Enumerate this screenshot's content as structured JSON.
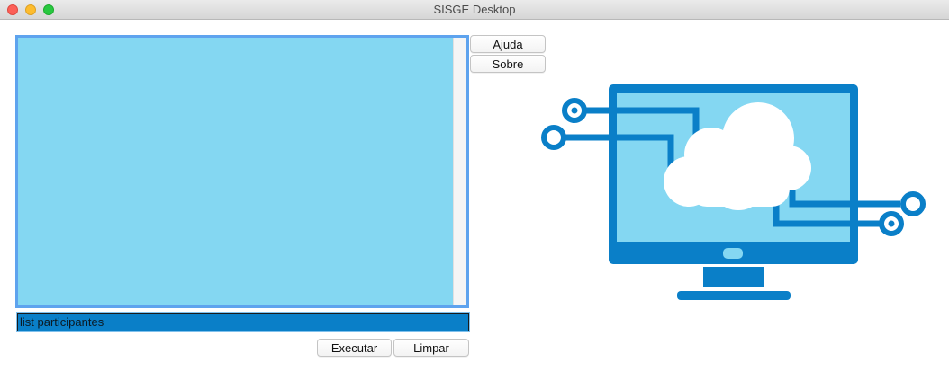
{
  "window": {
    "title": "SISGE Desktop"
  },
  "buttons": {
    "help": "Ajuda",
    "about": "Sobre",
    "execute": "Executar",
    "clear": "Limpar"
  },
  "command": {
    "value": "list participantes"
  },
  "output": {
    "text": ""
  },
  "illustration": {
    "icon": "cloud-computer-icon",
    "colors": {
      "frame": "#0a7fc8",
      "screen": "#84d7f2",
      "cloud": "#ffffff"
    }
  }
}
